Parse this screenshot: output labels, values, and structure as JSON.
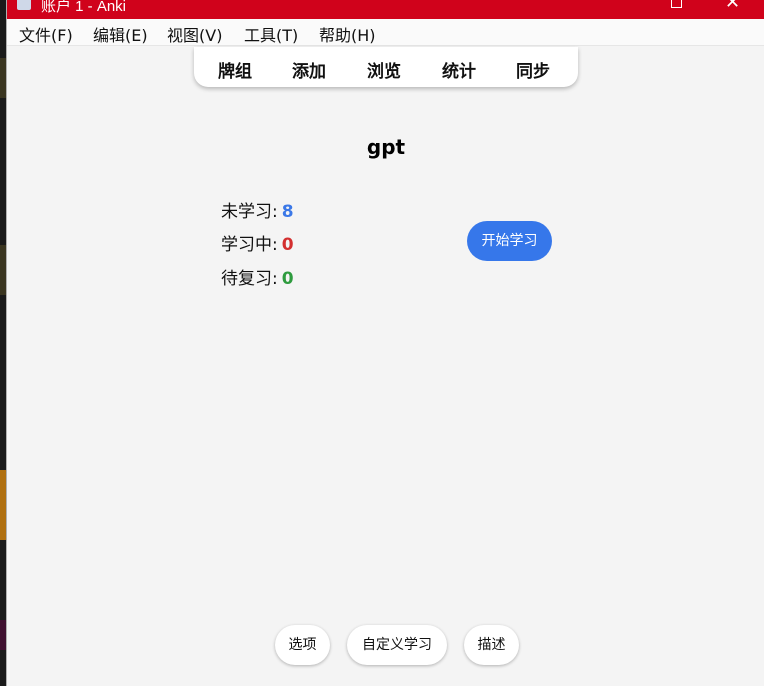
{
  "window": {
    "title": "账户 1 - Anki",
    "close_glyph": "✕"
  },
  "menu": {
    "items": [
      "文件(F)",
      "编辑(E)",
      "视图(V)",
      "工具(T)",
      "帮助(H)"
    ]
  },
  "toolbar": {
    "items": [
      "牌组",
      "添加",
      "浏览",
      "统计",
      "同步"
    ]
  },
  "deck": {
    "name": "gpt",
    "stats": [
      {
        "label": "未学习:",
        "value": "8",
        "color": "#3b78e7"
      },
      {
        "label": "学习中:",
        "value": "0",
        "color": "#d32f2f"
      },
      {
        "label": "待复习:",
        "value": "0",
        "color": "#2e9b3e"
      }
    ],
    "study_button": "开始学习"
  },
  "bottom_bar": {
    "options": "选项",
    "custom_study": "自定义学习",
    "description": "描述"
  },
  "colors": {
    "titlebar": "#d0021b",
    "accent": "#3677ea",
    "background": "#f4f4f4"
  }
}
